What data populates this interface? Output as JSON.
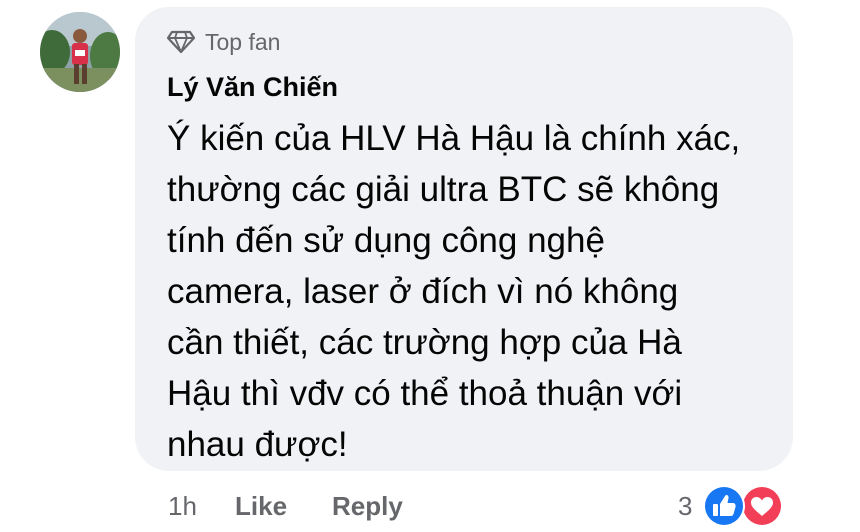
{
  "badge": {
    "icon": "diamond-icon",
    "label": "Top fan"
  },
  "author": {
    "name": "Lý Văn Chiến"
  },
  "comment": {
    "lines": [
      "Ý kiến của HLV Hà Hậu là chính xác,",
      "thường các giải ultra BTC sẽ không",
      "tính đến sử dụng công nghệ",
      "camera, laser ở đích vì nó không",
      "cần thiết, các trường hợp của Hà",
      "Hậu thì vđv có thể thoả thuận với",
      "nhau được!"
    ]
  },
  "footer": {
    "time": "1h",
    "like_label": "Like",
    "reply_label": "Reply",
    "reaction_count": "3"
  },
  "reactions": [
    {
      "type": "like",
      "icon": "thumbs-up-icon",
      "color": "#1877f2"
    },
    {
      "type": "love",
      "icon": "heart-icon",
      "color": "#f33e58"
    }
  ],
  "colors": {
    "bubble": "#f0f2f5",
    "text": "#050505",
    "muted": "#65676b"
  }
}
